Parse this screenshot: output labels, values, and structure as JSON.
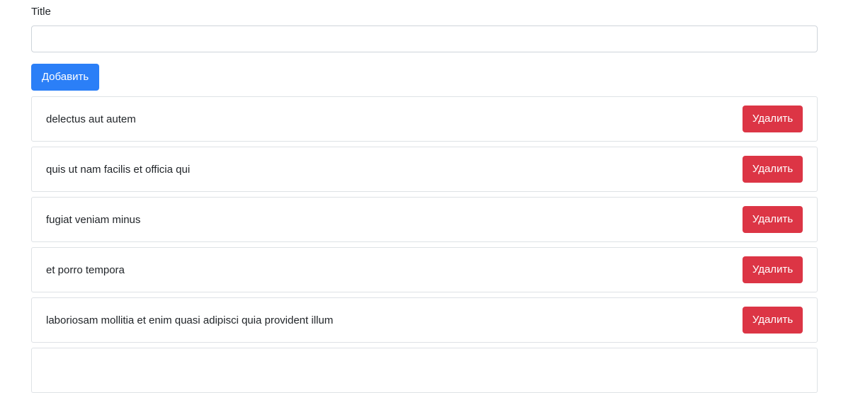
{
  "form": {
    "label": "Title",
    "value": "",
    "placeholder": "",
    "add_button_label": "Добавить"
  },
  "items": [
    {
      "text": "delectus aut autem",
      "delete_label": "Удалить"
    },
    {
      "text": "quis ut nam facilis et officia qui",
      "delete_label": "Удалить"
    },
    {
      "text": "fugiat veniam minus",
      "delete_label": "Удалить"
    },
    {
      "text": "et porro tempora",
      "delete_label": "Удалить"
    },
    {
      "text": "laboriosam mollitia et enim quasi adipisci quia provident illum",
      "delete_label": "Удалить"
    },
    {
      "text": "",
      "delete_label": ""
    }
  ],
  "colors": {
    "primary": "#2b7ff7",
    "danger": "#dc3545",
    "border": "#dee2e6"
  }
}
